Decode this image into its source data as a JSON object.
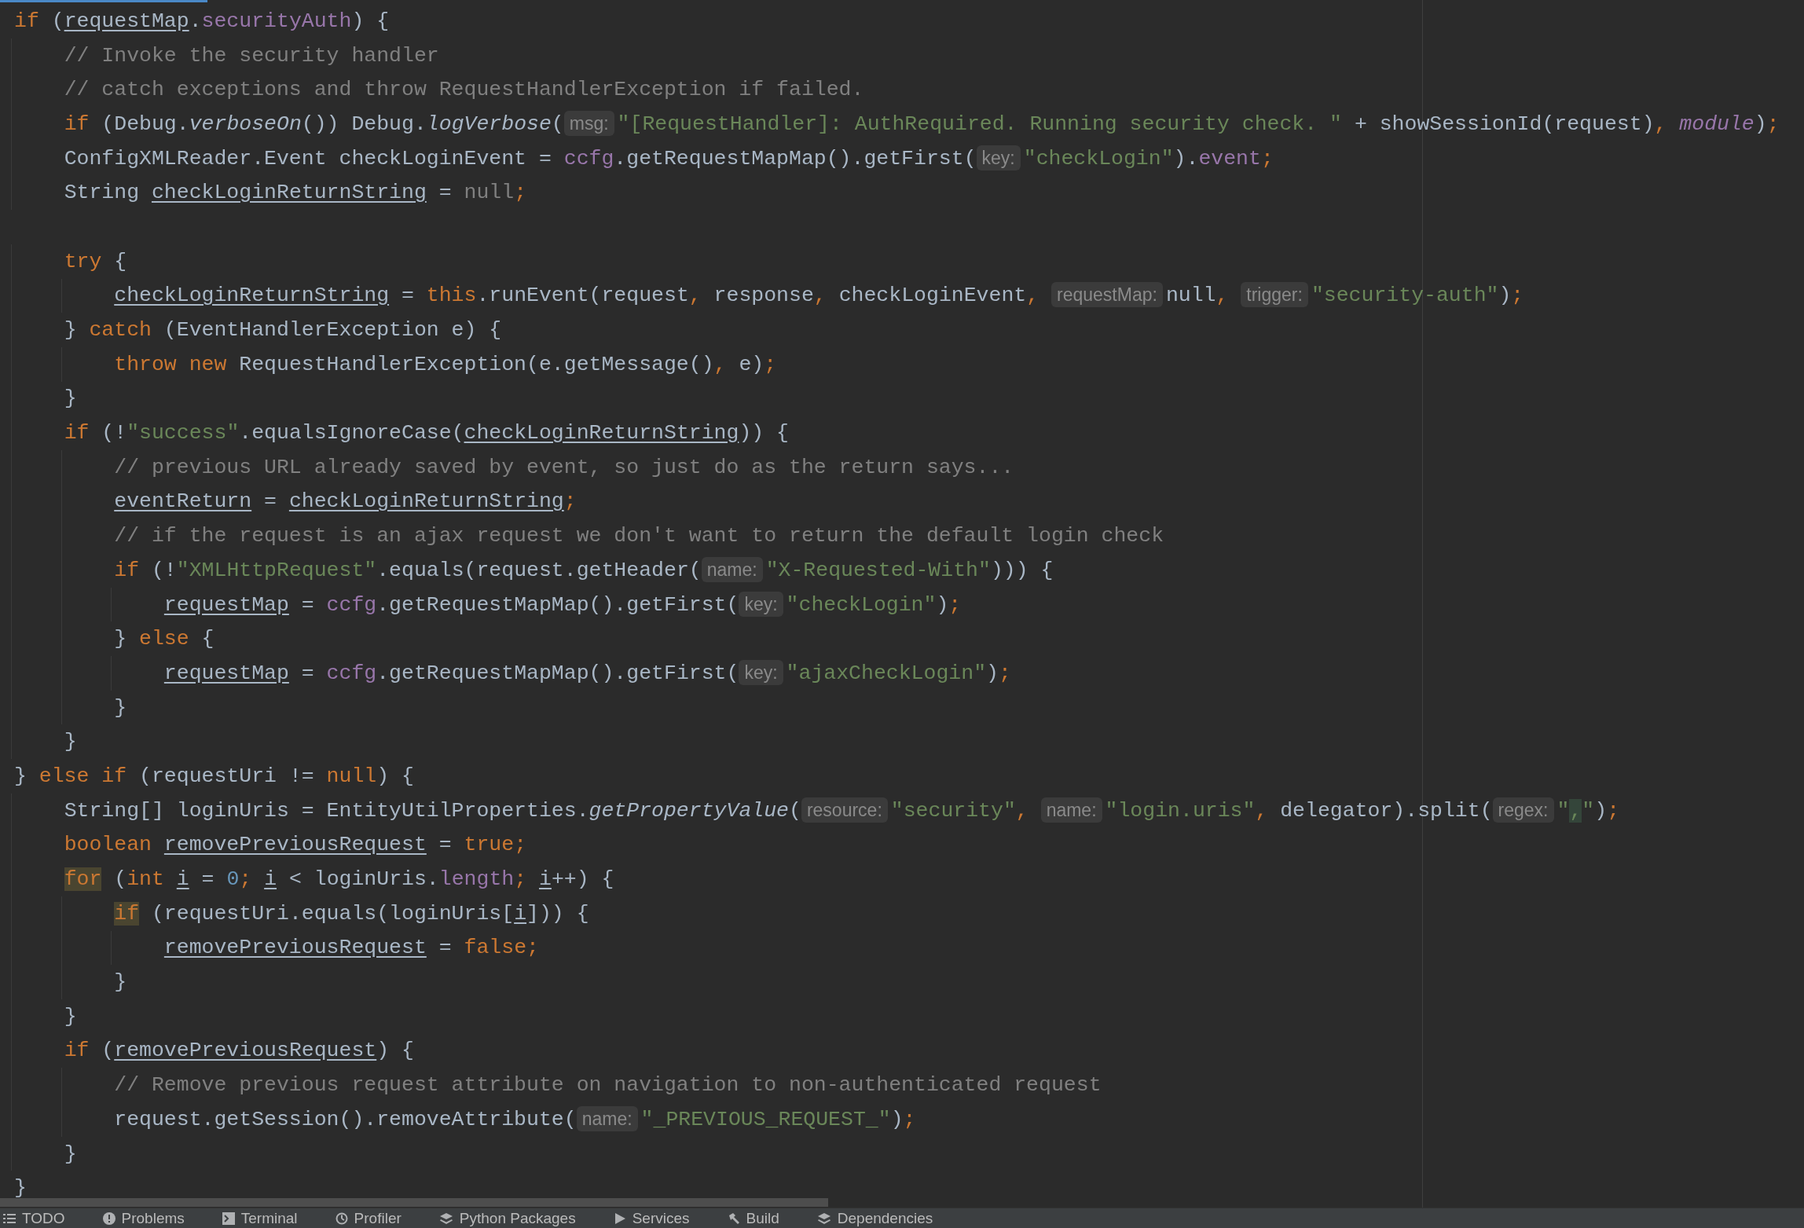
{
  "editor": {
    "lines": [
      {
        "kind": "code",
        "tokens": [
          {
            "kind": "kw",
            "text": "if"
          },
          {
            "kind": "plain",
            "text": " ("
          },
          {
            "kind": "var",
            "text": "requestMap"
          },
          {
            "kind": "plain",
            "text": "."
          },
          {
            "kind": "field",
            "text": "securityAuth"
          },
          {
            "kind": "plain",
            "text": ") {"
          }
        ]
      },
      {
        "kind": "code",
        "tokens": [
          {
            "kind": "comment",
            "text": "    // Invoke the security handler"
          }
        ]
      },
      {
        "kind": "code",
        "tokens": [
          {
            "kind": "comment",
            "text": "    // catch exceptions and throw RequestHandlerException if failed."
          }
        ]
      },
      {
        "kind": "code",
        "tokens": [
          {
            "kind": "kw",
            "text": "    if"
          },
          {
            "kind": "plain",
            "text": " (Debug."
          },
          {
            "kind": "italic",
            "text": "verboseOn"
          },
          {
            "kind": "plain",
            "text": "()) Debug."
          },
          {
            "kind": "italic",
            "text": "logVerbose"
          },
          {
            "kind": "plain",
            "text": "("
          },
          {
            "kind": "hint",
            "text": "msg:"
          },
          {
            "kind": "str",
            "text": "\"[RequestHandler]: AuthRequired. Running security check. \""
          },
          {
            "kind": "plain",
            "text": " + showSessionId(request)"
          },
          {
            "kind": "kw",
            "text": ", "
          },
          {
            "kind": "field_italic",
            "text": "module"
          },
          {
            "kind": "plain",
            "text": ")"
          },
          {
            "kind": "kw",
            "text": ";"
          }
        ]
      },
      {
        "kind": "code",
        "tokens": [
          {
            "kind": "plain",
            "text": "    ConfigXMLReader.Event checkLoginEvent = "
          },
          {
            "kind": "field",
            "text": "ccfg"
          },
          {
            "kind": "plain",
            "text": ".getRequestMapMap().getFirst("
          },
          {
            "kind": "hint",
            "text": "key:"
          },
          {
            "kind": "str",
            "text": "\"checkLogin\""
          },
          {
            "kind": "plain",
            "text": ")."
          },
          {
            "kind": "field",
            "text": "event"
          },
          {
            "kind": "kw",
            "text": ";"
          }
        ]
      },
      {
        "kind": "code",
        "tokens": [
          {
            "kind": "plain",
            "text": "    String "
          },
          {
            "kind": "var",
            "text": "checkLoginReturnString"
          },
          {
            "kind": "plain",
            "text": " = "
          },
          {
            "kind": "unused",
            "text": "null"
          },
          {
            "kind": "kw",
            "text": ";"
          }
        ]
      },
      {
        "kind": "blank"
      },
      {
        "kind": "code",
        "tokens": [
          {
            "kind": "kw",
            "text": "    try"
          },
          {
            "kind": "plain",
            "text": " {"
          }
        ]
      },
      {
        "kind": "code",
        "tokens": [
          {
            "kind": "var",
            "text": "        checkLoginReturnString"
          },
          {
            "kind": "plain",
            "text": " = "
          },
          {
            "kind": "kw",
            "text": "this"
          },
          {
            "kind": "plain",
            "text": ".runEvent(request"
          },
          {
            "kind": "kw",
            "text": ", "
          },
          {
            "kind": "plain",
            "text": "response"
          },
          {
            "kind": "kw",
            "text": ", "
          },
          {
            "kind": "plain",
            "text": "checkLoginEvent"
          },
          {
            "kind": "kw",
            "text": ", "
          },
          {
            "kind": "hint",
            "text": "requestMap:"
          },
          {
            "kind": "plain",
            "text": "null"
          },
          {
            "kind": "kw",
            "text": ", "
          },
          {
            "kind": "hint",
            "text": "trigger:"
          },
          {
            "kind": "str",
            "text": "\"security-auth\""
          },
          {
            "kind": "plain",
            "text": ")"
          },
          {
            "kind": "kw",
            "text": ";"
          }
        ]
      },
      {
        "kind": "code",
        "tokens": [
          {
            "kind": "plain",
            "text": "    } "
          },
          {
            "kind": "kw",
            "text": "catch"
          },
          {
            "kind": "plain",
            "text": " (EventHandlerException e) {"
          }
        ]
      },
      {
        "kind": "code",
        "tokens": [
          {
            "kind": "kw",
            "text": "        throw new"
          },
          {
            "kind": "plain",
            "text": " RequestHandlerException(e.getMessage()"
          },
          {
            "kind": "kw",
            "text": ", "
          },
          {
            "kind": "plain",
            "text": "e)"
          },
          {
            "kind": "kw",
            "text": ";"
          }
        ]
      },
      {
        "kind": "code",
        "tokens": [
          {
            "kind": "plain",
            "text": "    }"
          }
        ]
      },
      {
        "kind": "code",
        "tokens": [
          {
            "kind": "kw",
            "text": "    if"
          },
          {
            "kind": "plain",
            "text": " (!"
          },
          {
            "kind": "str",
            "text": "\"success\""
          },
          {
            "kind": "plain",
            "text": ".equalsIgnoreCase("
          },
          {
            "kind": "var",
            "text": "checkLoginReturnString"
          },
          {
            "kind": "plain",
            "text": ")) {"
          }
        ]
      },
      {
        "kind": "code",
        "tokens": [
          {
            "kind": "comment",
            "text": "        // previous URL already saved by event, so just do as the return says..."
          }
        ]
      },
      {
        "kind": "code",
        "tokens": [
          {
            "kind": "var",
            "text": "        eventReturn"
          },
          {
            "kind": "plain",
            "text": " = "
          },
          {
            "kind": "var",
            "text": "checkLoginReturnString"
          },
          {
            "kind": "kw",
            "text": ";"
          }
        ]
      },
      {
        "kind": "code",
        "tokens": [
          {
            "kind": "comment",
            "text": "        // if the request is an ajax request we don't want to return the default login check"
          }
        ]
      },
      {
        "kind": "code",
        "tokens": [
          {
            "kind": "kw",
            "text": "        if"
          },
          {
            "kind": "plain",
            "text": " (!"
          },
          {
            "kind": "str",
            "text": "\"XMLHttpRequest\""
          },
          {
            "kind": "plain",
            "text": ".equals(request.getHeader("
          },
          {
            "kind": "hint",
            "text": "name:"
          },
          {
            "kind": "str",
            "text": "\"X-Requested-With\""
          },
          {
            "kind": "plain",
            "text": "))) {"
          }
        ]
      },
      {
        "kind": "code",
        "tokens": [
          {
            "kind": "var",
            "text": "            requestMap"
          },
          {
            "kind": "plain",
            "text": " = "
          },
          {
            "kind": "field",
            "text": "ccfg"
          },
          {
            "kind": "plain",
            "text": ".getRequestMapMap().getFirst("
          },
          {
            "kind": "hint",
            "text": "key:"
          },
          {
            "kind": "str",
            "text": "\"checkLogin\""
          },
          {
            "kind": "plain",
            "text": ")"
          },
          {
            "kind": "kw",
            "text": ";"
          }
        ]
      },
      {
        "kind": "code",
        "tokens": [
          {
            "kind": "plain",
            "text": "        } "
          },
          {
            "kind": "kw",
            "text": "else"
          },
          {
            "kind": "plain",
            "text": " {"
          }
        ]
      },
      {
        "kind": "code",
        "tokens": [
          {
            "kind": "var",
            "text": "            requestMap"
          },
          {
            "kind": "plain",
            "text": " = "
          },
          {
            "kind": "field",
            "text": "ccfg"
          },
          {
            "kind": "plain",
            "text": ".getRequestMapMap().getFirst("
          },
          {
            "kind": "hint",
            "text": "key:"
          },
          {
            "kind": "str",
            "text": "\"ajaxCheckLogin\""
          },
          {
            "kind": "plain",
            "text": ")"
          },
          {
            "kind": "kw",
            "text": ";"
          }
        ]
      },
      {
        "kind": "code",
        "tokens": [
          {
            "kind": "plain",
            "text": "        }"
          }
        ]
      },
      {
        "kind": "code",
        "tokens": [
          {
            "kind": "plain",
            "text": "    }"
          }
        ]
      },
      {
        "kind": "code",
        "tokens": [
          {
            "kind": "plain",
            "text": "} "
          },
          {
            "kind": "kw",
            "text": "else if"
          },
          {
            "kind": "plain",
            "text": " (requestUri != "
          },
          {
            "kind": "kw",
            "text": "null"
          },
          {
            "kind": "plain",
            "text": ") {"
          }
        ]
      },
      {
        "kind": "code",
        "tokens": [
          {
            "kind": "plain",
            "text": "    String[] loginUris = EntityUtilProperties."
          },
          {
            "kind": "italic",
            "text": "getPropertyValue"
          },
          {
            "kind": "plain",
            "text": "("
          },
          {
            "kind": "hint",
            "text": "resource:"
          },
          {
            "kind": "str",
            "text": "\"security\""
          },
          {
            "kind": "kw",
            "text": ", "
          },
          {
            "kind": "hint",
            "text": "name:"
          },
          {
            "kind": "str",
            "text": "\"login.uris\""
          },
          {
            "kind": "kw",
            "text": ", "
          },
          {
            "kind": "plain",
            "text": "delegator).split("
          },
          {
            "kind": "hint",
            "text": "regex:"
          },
          {
            "kind": "str",
            "text": "\""
          },
          {
            "kind": "str_match",
            "text": ","
          },
          {
            "kind": "str",
            "text": "\""
          },
          {
            "kind": "plain",
            "text": ")"
          },
          {
            "kind": "kw",
            "text": ";"
          }
        ]
      },
      {
        "kind": "code",
        "tokens": [
          {
            "kind": "kw",
            "text": "    boolean "
          },
          {
            "kind": "var",
            "text": "removePreviousRequest"
          },
          {
            "kind": "plain",
            "text": " = "
          },
          {
            "kind": "kw",
            "text": "true;"
          }
        ]
      },
      {
        "kind": "code",
        "tokens": [
          {
            "kind": "kw_match",
            "text": "    for"
          },
          {
            "kind": "plain",
            "text": " ("
          },
          {
            "kind": "kw",
            "text": "int "
          },
          {
            "kind": "var",
            "text": "i"
          },
          {
            "kind": "plain",
            "text": " = "
          },
          {
            "kind": "num",
            "text": "0"
          },
          {
            "kind": "kw",
            "text": "; "
          },
          {
            "kind": "var",
            "text": "i"
          },
          {
            "kind": "plain",
            "text": " < loginUris."
          },
          {
            "kind": "field",
            "text": "length"
          },
          {
            "kind": "kw",
            "text": "; "
          },
          {
            "kind": "var",
            "text": "i"
          },
          {
            "kind": "plain",
            "text": "++) {"
          }
        ]
      },
      {
        "kind": "code",
        "tokens": [
          {
            "kind": "kw_match",
            "text": "        if"
          },
          {
            "kind": "plain",
            "text": " (requestUri.equals(loginUris["
          },
          {
            "kind": "var",
            "text": "i"
          },
          {
            "kind": "plain",
            "text": "])) {"
          }
        ]
      },
      {
        "kind": "code",
        "tokens": [
          {
            "kind": "var",
            "text": "            removePreviousRequest"
          },
          {
            "kind": "plain",
            "text": " = "
          },
          {
            "kind": "kw",
            "text": "false;"
          }
        ]
      },
      {
        "kind": "code",
        "tokens": [
          {
            "kind": "plain",
            "text": "        }"
          }
        ]
      },
      {
        "kind": "code",
        "tokens": [
          {
            "kind": "plain",
            "text": "    }"
          }
        ]
      },
      {
        "kind": "code",
        "tokens": [
          {
            "kind": "kw",
            "text": "    if"
          },
          {
            "kind": "plain",
            "text": " ("
          },
          {
            "kind": "var",
            "text": "removePreviousRequest"
          },
          {
            "kind": "plain",
            "text": ") {"
          }
        ]
      },
      {
        "kind": "code",
        "tokens": [
          {
            "kind": "comment",
            "text": "        // Remove previous request attribute on navigation to non-authenticated request"
          }
        ]
      },
      {
        "kind": "code",
        "tokens": [
          {
            "kind": "plain",
            "text": "        request.getSession().removeAttribute("
          },
          {
            "kind": "hint",
            "text": "name:"
          },
          {
            "kind": "str",
            "text": "\"_PREVIOUS_REQUEST_\""
          },
          {
            "kind": "plain",
            "text": ")"
          },
          {
            "kind": "kw",
            "text": ";"
          }
        ]
      },
      {
        "kind": "code",
        "tokens": [
          {
            "kind": "plain",
            "text": "    }"
          }
        ]
      },
      {
        "kind": "code",
        "tokens": [
          {
            "kind": "plain",
            "text": "}"
          }
        ]
      }
    ]
  },
  "tool_windows": [
    {
      "kind": "list",
      "label": "TODO"
    },
    {
      "kind": "info",
      "label": "Problems"
    },
    {
      "kind": "terminal",
      "label": "Terminal"
    },
    {
      "kind": "profiler",
      "label": "Profiler"
    },
    {
      "kind": "layers",
      "label": "Python Packages"
    },
    {
      "kind": "play",
      "label": "Services"
    },
    {
      "kind": "hammer",
      "label": "Build"
    },
    {
      "kind": "layers",
      "label": "Dependencies"
    }
  ]
}
